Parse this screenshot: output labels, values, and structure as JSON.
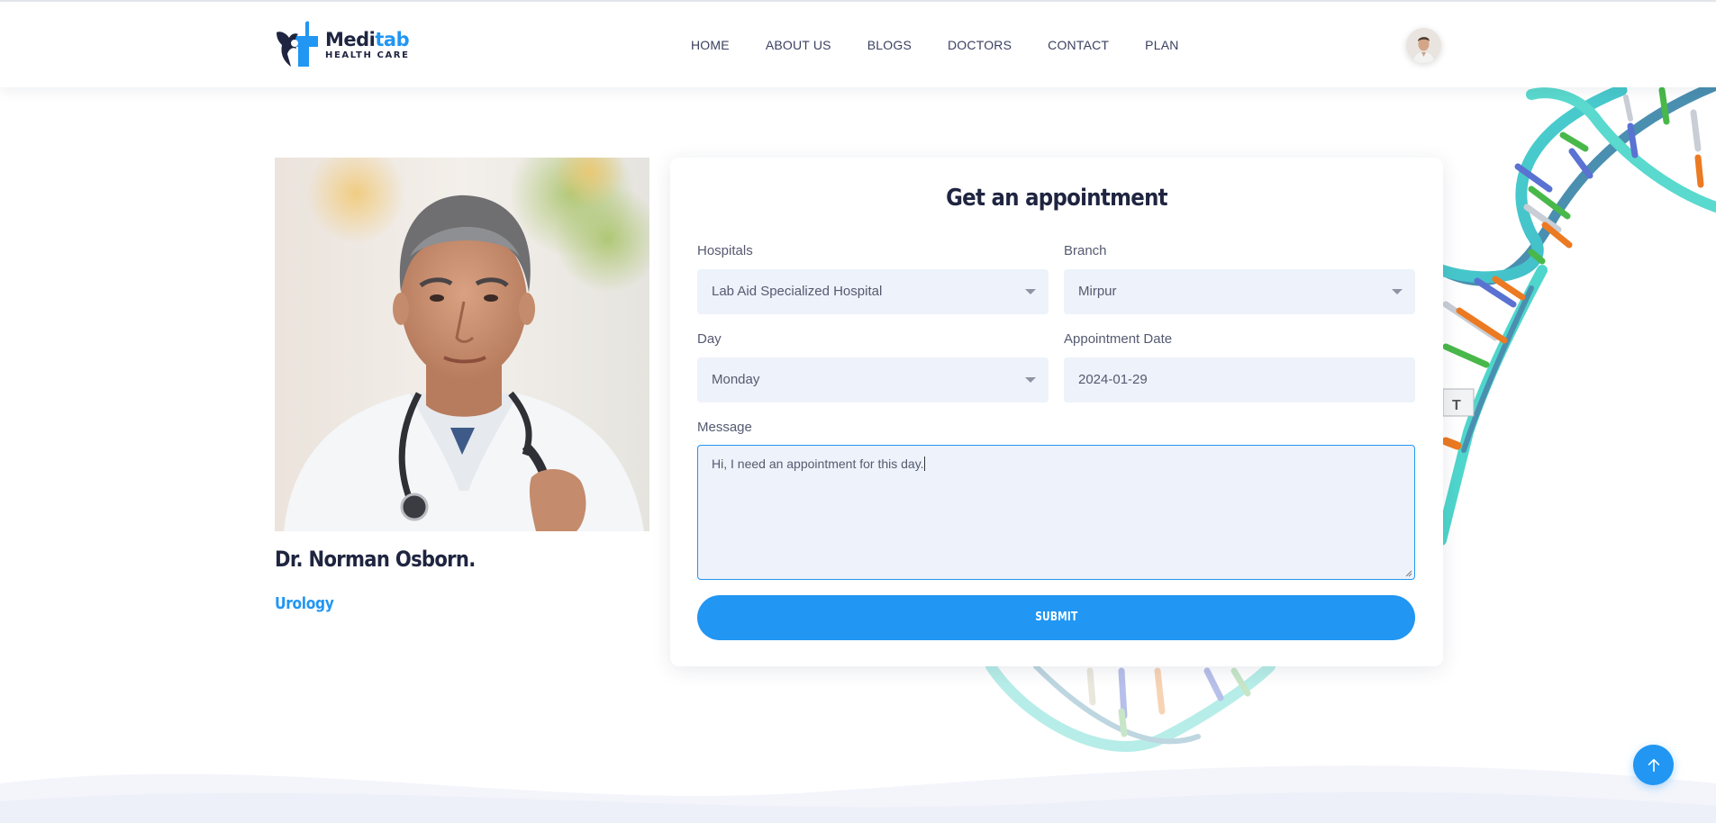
{
  "brand": {
    "name_part1": "Medi",
    "name_part2": "tab",
    "tagline": "HEALTH CARE"
  },
  "nav": {
    "items": [
      "HOME",
      "ABOUT US",
      "BLOGS",
      "DOCTORS",
      "CONTACT",
      "PLAN"
    ]
  },
  "doctor": {
    "name": "Dr. Norman Osborn.",
    "department": "Urology"
  },
  "form": {
    "title": "Get an appointment",
    "hospitals": {
      "label": "Hospitals",
      "value": "Lab Aid Specialized Hospital"
    },
    "branch": {
      "label": "Branch",
      "value": "Mirpur"
    },
    "day": {
      "label": "Day",
      "value": "Monday"
    },
    "appointment_date": {
      "label": "Appointment Date",
      "value": "2024-01-29"
    },
    "message": {
      "label": "Message",
      "value": "Hi, I need an appointment for this day."
    },
    "submit_label": "SUBMIT"
  },
  "colors": {
    "accent": "#2196f3",
    "dark": "#1f2540",
    "field_bg": "#eef2fa"
  },
  "icons": {
    "logo": "medical-cross-logo-icon",
    "avatar": "user-avatar",
    "back_to_top": "arrow-up-icon",
    "select_caret": "caret-down-icon"
  }
}
